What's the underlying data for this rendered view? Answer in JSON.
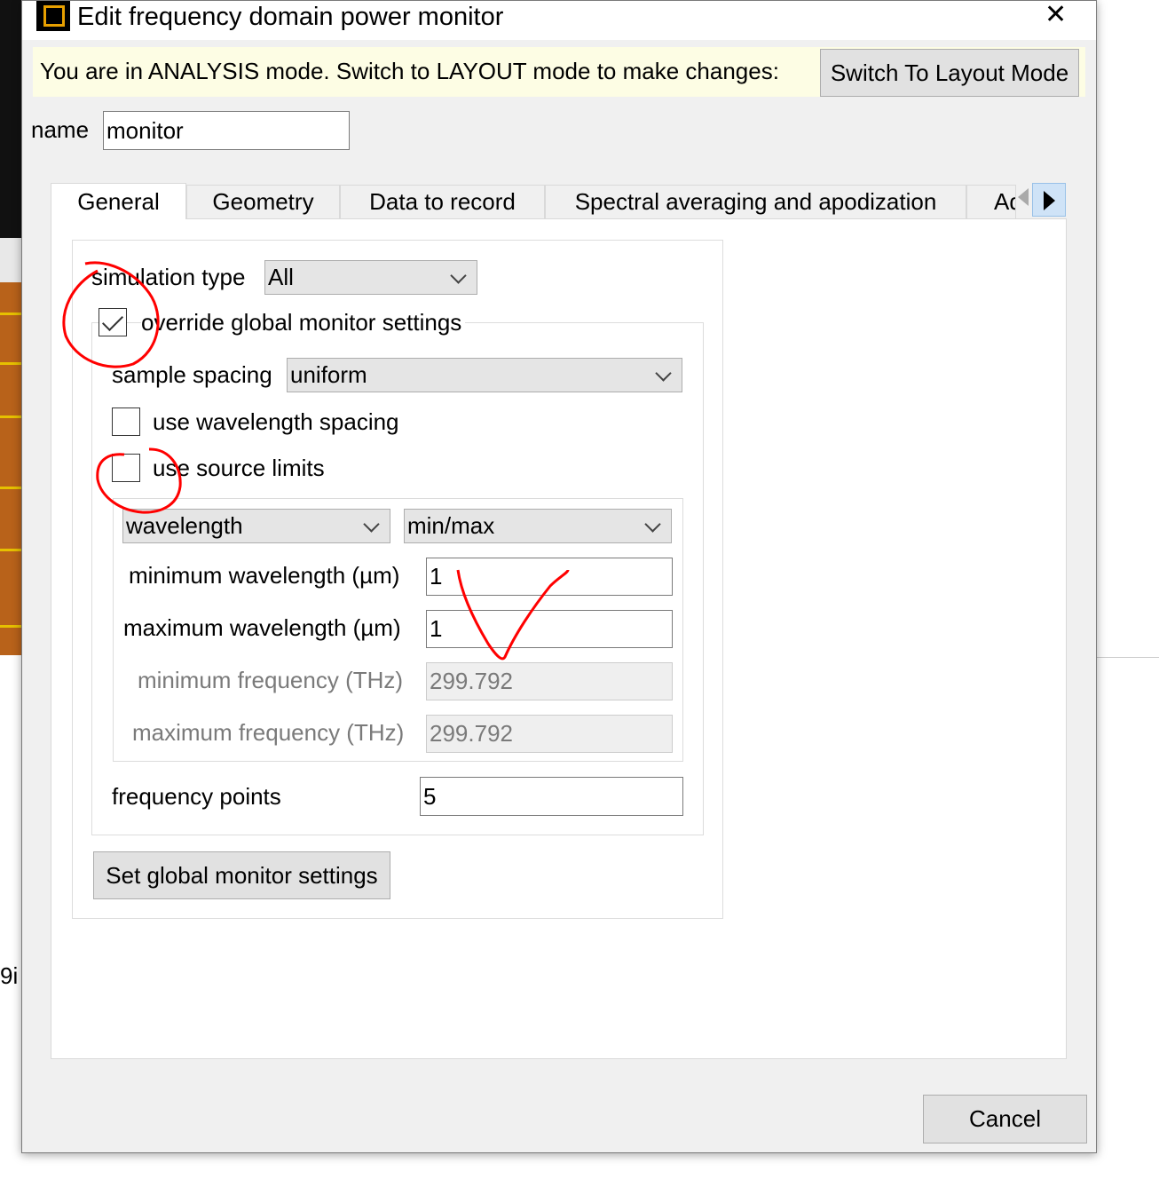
{
  "background": {
    "side_text": "9i"
  },
  "dialog": {
    "title": "Edit frequency domain power monitor",
    "mode_message": "You are in ANALYSIS mode.  Switch to LAYOUT mode to make changes:",
    "switch_button": "Switch To Layout Mode",
    "name_label": "name",
    "name_value": "monitor",
    "tabs": [
      {
        "label": "General",
        "active": true
      },
      {
        "label": "Geometry",
        "active": false
      },
      {
        "label": "Data to record",
        "active": false
      },
      {
        "label": "Spectral averaging and apodization",
        "active": false
      },
      {
        "label": "Advanc",
        "active": false
      }
    ],
    "general": {
      "simulation_type_label": "simulation type",
      "simulation_type_value": "All",
      "override_label": "override global monitor settings",
      "override_checked": true,
      "sample_spacing_label": "sample spacing",
      "sample_spacing_value": "uniform",
      "use_wavelength_spacing_label": "use wavelength spacing",
      "use_wavelength_spacing_checked": false,
      "use_source_limits_label": "use source limits",
      "use_source_limits_checked": false,
      "range_type_value": "wavelength",
      "range_mode_value": "min/max",
      "min_wavelength_label": "minimum wavelength (µm)",
      "min_wavelength_value": "1",
      "max_wavelength_label": "maximum wavelength (µm)",
      "max_wavelength_value": "1",
      "min_frequency_label": "minimum frequency (THz)",
      "min_frequency_value": "299.792",
      "max_frequency_label": "maximum frequency (THz)",
      "max_frequency_value": "299.792",
      "frequency_points_label": "frequency points",
      "frequency_points_value": "5",
      "global_settings_button": "Set global monitor settings"
    },
    "cancel_button": "Cancel"
  },
  "colors": {
    "mode_bar_bg": "#fdfde4",
    "annotation_red": "#ff0000",
    "title_icon_accent": "#e8a000"
  }
}
